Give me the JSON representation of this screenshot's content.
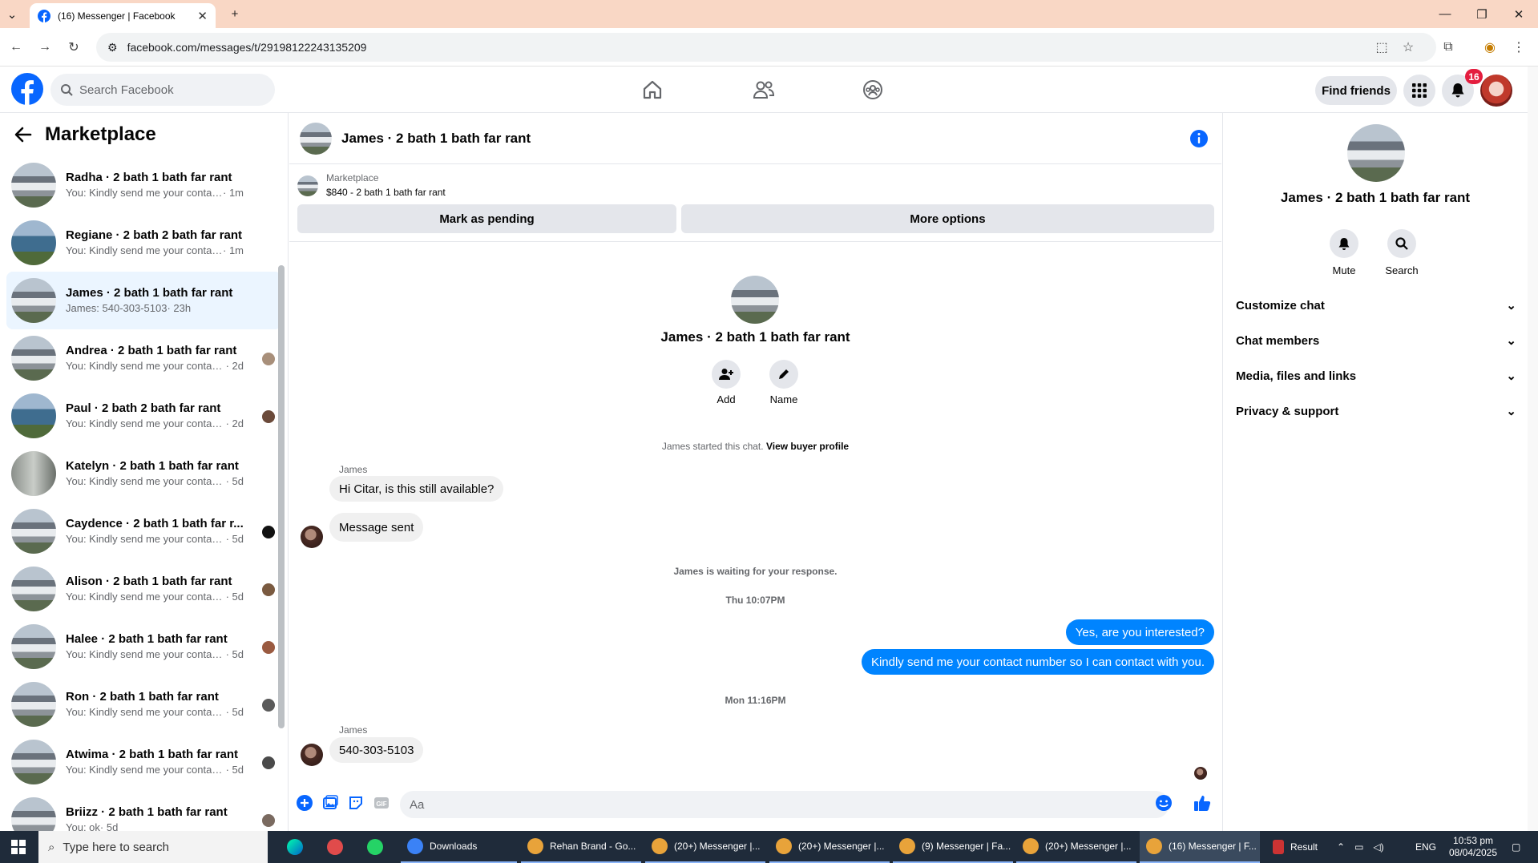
{
  "browser": {
    "tab_title": "(16) Messenger | Facebook",
    "url": "facebook.com/messages/t/29198122243135209"
  },
  "fb": {
    "search_placeholder": "Search Facebook",
    "find_friends": "Find friends",
    "notif_count": "16"
  },
  "left": {
    "title": "Marketplace",
    "conversations": [
      {
        "title": "Radha · 2 bath 1 bath far rant",
        "snippet": "You: Kindly send me your contact ...",
        "time": " · 1m"
      },
      {
        "title": "Regiane · 2 bath 2 bath far rant",
        "snippet": "You: Kindly send me your contact ...",
        "time": " · 1m"
      },
      {
        "title": "James · 2 bath 1 bath far rant",
        "snippet": "James: 540-303-5103",
        "time": " · 23h"
      },
      {
        "title": "Andrea · 2 bath 1 bath far rant",
        "snippet": "You: Kindly send me your contac...",
        "time": " · 2d"
      },
      {
        "title": "Paul · 2 bath 2 bath far rant",
        "snippet": "You: Kindly send me your contac...",
        "time": " · 2d"
      },
      {
        "title": "Katelyn · 2 bath 1 bath far rant",
        "snippet": "You: Kindly send me your contact n...",
        "time": " · 5d"
      },
      {
        "title": "Caydence · 2 bath 1 bath far r...",
        "snippet": "You: Kindly send me your contac...",
        "time": " · 5d"
      },
      {
        "title": "Alison · 2 bath 1 bath far rant",
        "snippet": "You: Kindly send me your contac...",
        "time": " · 5d"
      },
      {
        "title": "Halee · 2 bath 1 bath far rant",
        "snippet": "You: Kindly send me your contac...",
        "time": " · 5d"
      },
      {
        "title": "Ron · 2 bath 1 bath far rant",
        "snippet": "You: Kindly send me your contac...",
        "time": " · 5d"
      },
      {
        "title": "Atwima · 2 bath 1 bath far rant",
        "snippet": "You: Kindly send me your contac...",
        "time": " · 5d"
      },
      {
        "title": "Briizz · 2 bath 1 bath far rant",
        "snippet": "You: ok",
        "time": " · 5d"
      }
    ]
  },
  "chat": {
    "header_title": "James · 2 bath 1 bath far rant",
    "marketplace_label": "Marketplace",
    "listing": "$840 - 2 bath 1 bath far rant",
    "mark_pending": "Mark as pending",
    "more_options": "More options",
    "profile_name": "James · 2 bath 1 bath far rant",
    "add_label": "Add",
    "name_label": "Name",
    "started_text": "James started this chat.",
    "view_buyer": "View buyer profile",
    "sender1": "James",
    "msg1": "Hi Citar, is this still available?",
    "msg2": "Message sent",
    "waiting": "James is waiting for your response.",
    "ts1": "Thu 10:07PM",
    "out1": "Yes, are you interested?",
    "out2": "Kindly send me your contact number so I can contact with you.",
    "ts2": "Mon 11:16PM",
    "sender2": "James",
    "msg3": "540-303-5103",
    "composer_placeholder": "Aa"
  },
  "right": {
    "name": "James · 2 bath 1 bath far rant",
    "mute": "Mute",
    "search": "Search",
    "sections": [
      "Customize chat",
      "Chat members",
      "Media, files and links",
      "Privacy & support"
    ]
  },
  "taskbar": {
    "search_placeholder": "Type here to search",
    "items": [
      "Downloads",
      "Rehan Brand - Go...",
      "(20+) Messenger |...",
      "(20+) Messenger |...",
      "(9) Messenger | Fa...",
      "(20+) Messenger |...",
      "(16) Messenger | F..."
    ],
    "result": "Result",
    "lang": "ENG",
    "time": "10:53 pm",
    "date": "08/04/2025"
  },
  "colors": {
    "fb_blue": "#0866ff",
    "bubble_out": "#0084ff",
    "bubble_in": "#f0f0f0"
  }
}
